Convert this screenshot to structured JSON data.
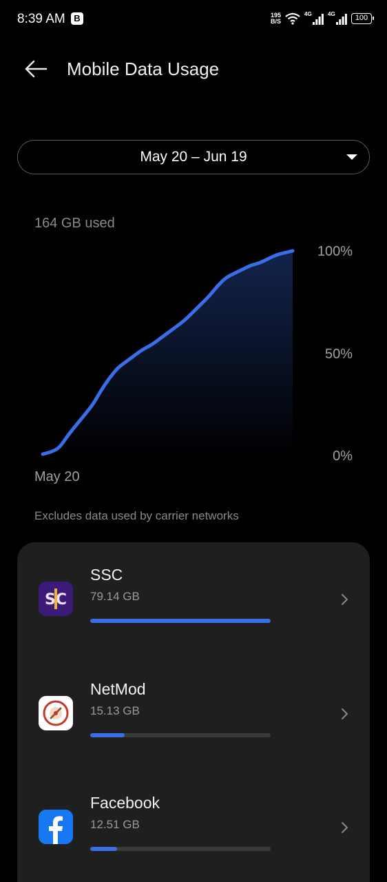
{
  "status_bar": {
    "time": "8:39 AM",
    "badge": "B",
    "net_speed_value": "195",
    "net_speed_unit": "B/S",
    "sim1_type": "4G",
    "sim2_type": "4G",
    "battery": "100"
  },
  "header": {
    "title": "Mobile Data Usage"
  },
  "period": {
    "label": "May 20 – Jun 19"
  },
  "usage": {
    "used_label": "164 GB used",
    "note": "Excludes data used by carrier networks"
  },
  "chart_data": {
    "type": "area",
    "x_start_label": "May 20",
    "y_ticks": [
      "100%",
      "50%",
      "0%"
    ],
    "ylim": [
      0,
      100
    ],
    "accent_color": "#3a6ee8",
    "values": [
      1,
      2,
      4,
      10,
      15,
      20,
      25,
      32,
      38,
      43,
      46,
      49,
      52,
      54,
      57,
      60,
      63,
      66,
      70,
      74,
      78,
      83,
      87,
      89,
      91,
      93,
      94,
      96,
      98,
      99,
      100
    ]
  },
  "apps": [
    {
      "name": "SSC",
      "size": "79.14 GB",
      "fraction": 1.0,
      "icon": "ssc-app-icon"
    },
    {
      "name": "NetMod",
      "size": "15.13 GB",
      "fraction": 0.19,
      "icon": "netmod-app-icon"
    },
    {
      "name": "Facebook",
      "size": "12.51 GB",
      "fraction": 0.15,
      "icon": "facebook-app-icon"
    }
  ]
}
